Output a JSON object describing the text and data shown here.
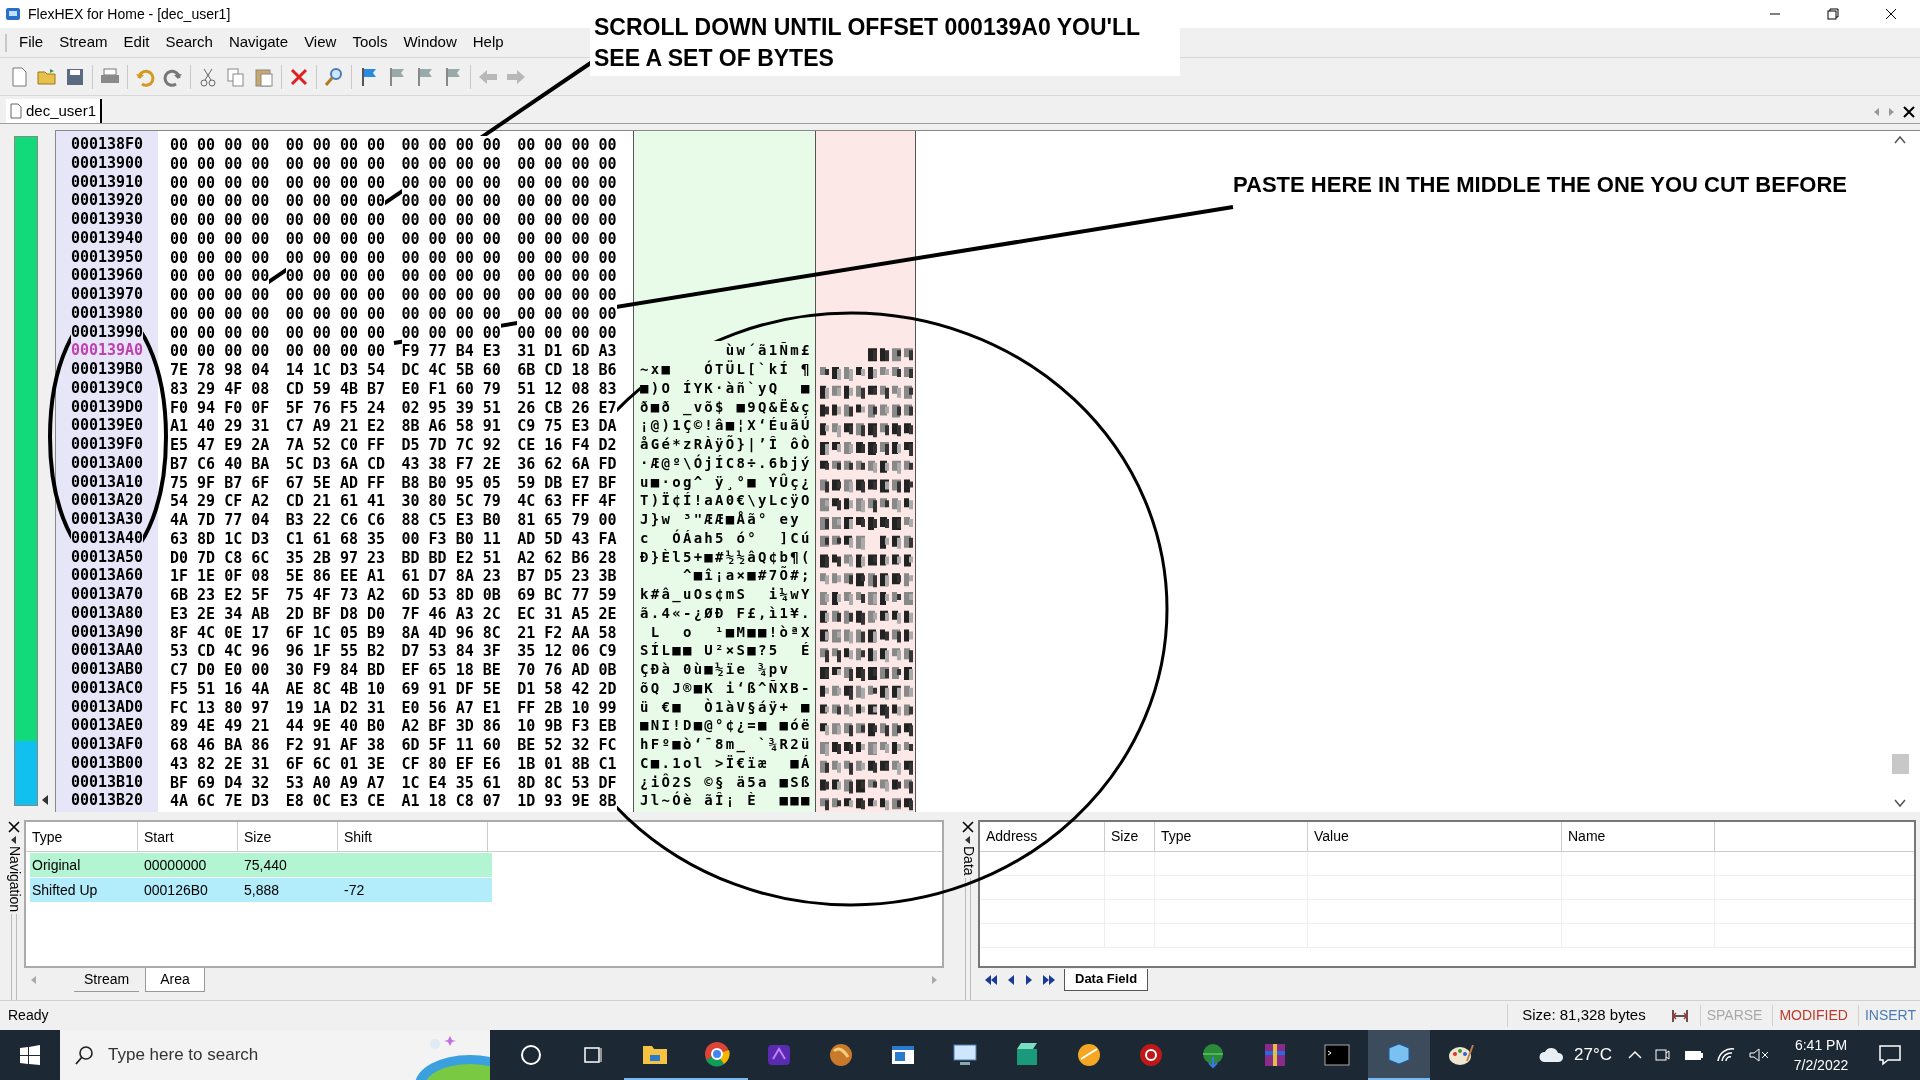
{
  "window": {
    "title": "FlexHEX for Home - [dec_user1]"
  },
  "menu": [
    "File",
    "Stream",
    "Edit",
    "Search",
    "Navigate",
    "View",
    "Tools",
    "Window",
    "Help"
  ],
  "document_tabs": [
    {
      "label": "dec_user1",
      "selected": true
    }
  ],
  "hex_view": {
    "rows": [
      {
        "address": "000138F0",
        "bytes": "00 00 00 00 00 00 00 00 00 00 00 00 00 00 00 00",
        "selected": false
      },
      {
        "address": "00013900",
        "bytes": "00 00 00 00 00 00 00 00 00 00 00 00 00 00 00 00",
        "selected": false
      },
      {
        "address": "00013910",
        "bytes": "00 00 00 00 00 00 00 00 00 00 00 00 00 00 00 00",
        "selected": false
      },
      {
        "address": "00013920",
        "bytes": "00 00 00 00 00 00 00 00 00 00 00 00 00 00 00 00",
        "selected": false
      },
      {
        "address": "00013930",
        "bytes": "00 00 00 00 00 00 00 00 00 00 00 00 00 00 00 00",
        "selected": false
      },
      {
        "address": "00013940",
        "bytes": "00 00 00 00 00 00 00 00 00 00 00 00 00 00 00 00",
        "selected": false
      },
      {
        "address": "00013950",
        "bytes": "00 00 00 00 00 00 00 00 00 00 00 00 00 00 00 00",
        "selected": false
      },
      {
        "address": "00013960",
        "bytes": "00 00 00 00 00 00 00 00 00 00 00 00 00 00 00 00",
        "selected": false
      },
      {
        "address": "00013970",
        "bytes": "00 00 00 00 00 00 00 00 00 00 00 00 00 00 00 00",
        "selected": false
      },
      {
        "address": "00013980",
        "bytes": "00 00 00 00 00 00 00 00 00 00 00 00 00 00 00 00",
        "selected": false
      },
      {
        "address": "00013990",
        "bytes": "00 00 00 00 00 00 00 00 00 00 00 00 00 00 00 00",
        "selected": false
      },
      {
        "address": "000139A0",
        "bytes": "00 00 00 00 00 00 00 00 F9 77 B4 E3 31 D1 6D A3",
        "text": "        ùw´ã1Ñm£",
        "selected": true
      },
      {
        "address": "000139B0",
        "bytes": "7E 78 98 04 14 1C D3 54 DC 4C 5B 60 6B CD 18 B6",
        "text": "~x■   ÓTÜL[`kÍ ¶",
        "selected": false
      },
      {
        "address": "000139C0",
        "bytes": "83 29 4F 08 CD 59 4B B7 E0 F1 60 79 51 12 08 83",
        "text": "■)O ÍYK·àñ`yQ  ■",
        "selected": false
      },
      {
        "address": "000139D0",
        "bytes": "F0 94 F0 0F 5F 76 F5 24 02 95 39 51 26 CB 26 E7",
        "text": "ð■ð _võ$ ■9Q&Ë&ç",
        "selected": false
      },
      {
        "address": "000139E0",
        "bytes": "A1 40 29 31 C7 A9 21 E2 8B A6 58 91 C9 75 E3 DA",
        "text": "¡@)1Ç©!â■¦X‘ÉuãÚ",
        "selected": false
      },
      {
        "address": "000139F0",
        "bytes": "E5 47 E9 2A 7A 52 C0 FF D5 7D 7C 92 CE 16 F4 D2",
        "text": "åGé*zRÀÿÕ}|’Î ôÒ",
        "selected": false
      },
      {
        "address": "00013A00",
        "bytes": "B7 C6 40 BA 5C D3 6A CD 43 38 F7 2E 36 62 6A FD",
        "text": "·Æ@º\\ÓjÍC8÷.6bjý",
        "selected": false
      },
      {
        "address": "00013A10",
        "bytes": "75 9F B7 6F 67 5E AD FF B8 B0 95 05 59 DB E7 BF",
        "text": "u■·og^ ÿ¸°■ YÛç¿",
        "selected": false
      },
      {
        "address": "00013A20",
        "bytes": "54 29 CF A2 CD 21 61 41 30 80 5C 79 4C 63 FF 4F",
        "text": "T)Ï¢Í!aA0€\\yLcÿO",
        "selected": false
      },
      {
        "address": "00013A30",
        "bytes": "4A 7D 77 04 B3 22 C6 C6 88 C5 E3 B0 81 65 79 00",
        "text": "J}w ³\"ÆÆ■Åã° ey",
        "selected": false
      },
      {
        "address": "00013A40",
        "bytes": "63 8D 1C D3 C1 61 68 35 00 F3 B0 11 AD 5D 43 FA",
        "text": "c  ÓÁah5 ó°  ]Cú",
        "selected": false
      },
      {
        "address": "00013A50",
        "bytes": "D0 7D C8 6C 35 2B 97 23 BD BD E2 51 A2 62 B6 28",
        "text": "Ð}Èl5+■#½½âQ¢b¶(",
        "selected": false
      },
      {
        "address": "00013A60",
        "bytes": "1F 1E 0F 08 5E 86 EE A1 61 D7 8A 23 B7 D5 23 3B",
        "text": "    ^■î¡a×■#7Õ#;",
        "selected": false
      },
      {
        "address": "00013A70",
        "bytes": "6B 23 E2 5F 75 4F 73 A2 6D 53 8D 0B 69 BC 77 59",
        "text": "k#â_uOs¢mS  i¼wY",
        "selected": false
      },
      {
        "address": "00013A80",
        "bytes": "E3 2E 34 AB 2D BF D8 D0 7F 46 A3 2C EC 31 A5 2E",
        "text": "ã.4«-¿ØÐ F£,ì1¥.",
        "selected": false
      },
      {
        "address": "00013A90",
        "bytes": "8F 4C 0E 17 6F 1C 05 B9 8A 4D 96 8C 21 F2 AA 58",
        "text": " L  o  ¹■M■■!òªX",
        "selected": false
      },
      {
        "address": "00013AA0",
        "bytes": "53 CD 4C 96 96 1F 55 B2 D7 53 84 3F 35 12 06 C9",
        "text": "SÍL■■ U²×S■?5  É",
        "selected": false
      },
      {
        "address": "00013AB0",
        "bytes": "C7 D0 E0 00 30 F9 84 BD EF 65 18 BE 70 76 AD 0B",
        "text": "ÇÐà 0ù■½ïe ¾pv",
        "selected": false
      },
      {
        "address": "00013AC0",
        "bytes": "F5 51 16 4A AE 8C 4B 10 69 91 DF 5E D1 58 42 2D",
        "text": "õQ J®■K i‘ß^ÑXB-",
        "selected": false
      },
      {
        "address": "00013AD0",
        "bytes": "FC 13 80 97 19 1A D2 31 E0 56 A7 E1 FF 2B 10 99",
        "text": "ü €■  Ò1àV§áÿ+ ■",
        "selected": false
      },
      {
        "address": "00013AE0",
        "bytes": "89 4E 49 21 44 9E 40 B0 A2 BF 3D 86 10 9B F3 EB",
        "text": "■NI!D■@°¢¿=■ ■óë",
        "selected": false
      },
      {
        "address": "00013AF0",
        "bytes": "68 46 BA 86 F2 91 AF 38 6D 5F 11 60 BE 52 32 FC",
        "text": "hFº■ò‘¯8m_ `¾R2ü",
        "selected": false
      },
      {
        "address": "00013B00",
        "bytes": "43 82 2E 31 6F 6C 01 3E CF 80 EF E6 1B 01 8B C1",
        "text": "C■.1ol >Ï€ïæ  ■Á",
        "selected": false
      },
      {
        "address": "00013B10",
        "bytes": "BF 69 D4 32 53 A0 A9 A7 1C E4 35 61 8D 8C 53 DF",
        "text": "¿iÔ2S ©§ ä5a ■Sß",
        "selected": false
      },
      {
        "address": "00013B20",
        "bytes": "4A 6C 7E D3 E8 0C E3 CE A1 18 C8 07 1D 93 9E 8B",
        "text": "Jl~Óè ãÎ¡ È  ■■■",
        "selected": false
      }
    ]
  },
  "navigation_panel": {
    "title": "Navigation",
    "columns": [
      "Type",
      "Start",
      "Size",
      "Shift"
    ],
    "rows": [
      {
        "type": "Original",
        "start": "00000000",
        "size": "75,440",
        "color": "#b3f5d3"
      },
      {
        "type": "Shifted Up",
        "start": "000126B0",
        "size": "5,888",
        "shift": "-72",
        "color": "#b3ecfb"
      }
    ],
    "tabs": [
      {
        "label": "Stream",
        "selected": false
      },
      {
        "label": "Area",
        "selected": true
      }
    ]
  },
  "data_panel": {
    "title": "Data",
    "columns": [
      "Address",
      "Size",
      "Type",
      "Value",
      "Name"
    ],
    "tabs": [
      {
        "label": "Data Field",
        "selected": true
      }
    ]
  },
  "status_bar": {
    "message": "Ready",
    "size": "Size: 81,328 bytes",
    "indicators": [
      {
        "label": "SPARSE",
        "color": "#a8a8a8"
      },
      {
        "label": "MODIFIED",
        "color": "#c0392b"
      },
      {
        "label": "INSERT",
        "color": "#4a7ab5"
      }
    ]
  },
  "taskbar": {
    "search_placeholder": "Type here to search",
    "temperature": "27°C",
    "time": "6:41 PM",
    "date": "7/2/2022"
  },
  "annotations": {
    "scroll_note": "SCROLL DOWN UNTIL OFFSET 000139A0 YOU'LL SEE A SET OF BYTES",
    "paste_note": "PASTE HERE IN THE MIDDLE THE ONE YOU CUT BEFORE"
  }
}
